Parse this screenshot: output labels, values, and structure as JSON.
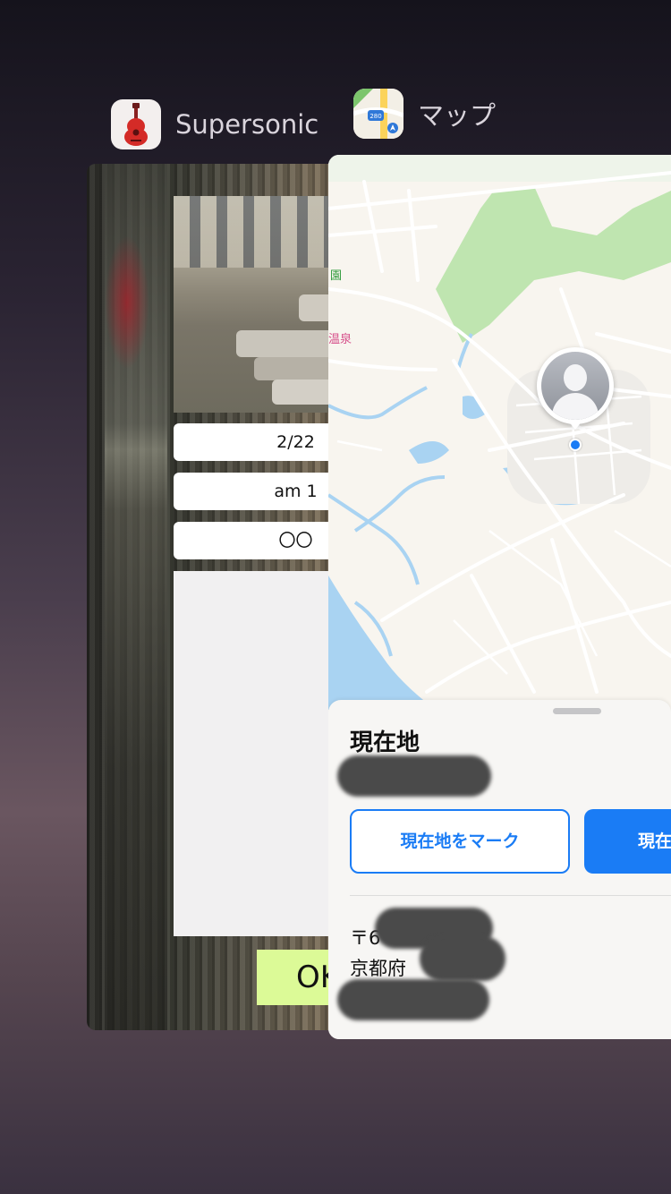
{
  "switcher": {
    "apps": [
      {
        "name": "Supersonic",
        "icon": "guitar-icon"
      },
      {
        "name": "マップ",
        "icon": "maps-app-icon"
      }
    ]
  },
  "supersonic": {
    "fields": [
      "2/22 ",
      "am 1",
      "〇〇"
    ],
    "ok_label": "OK"
  },
  "maps": {
    "labels": {
      "park": "園",
      "onsen": "温泉"
    },
    "sheet": {
      "title": "現在地",
      "mark_button": "現在地をマーク",
      "primary_button": "現在",
      "address_line1": "〒6",
      "address_line2": "京都府"
    },
    "colors": {
      "accent": "#1a7cf5",
      "park": "#bfe5b0",
      "water": "#a9d3f2",
      "road": "#ffffff",
      "land": "#f8f5ef"
    }
  }
}
